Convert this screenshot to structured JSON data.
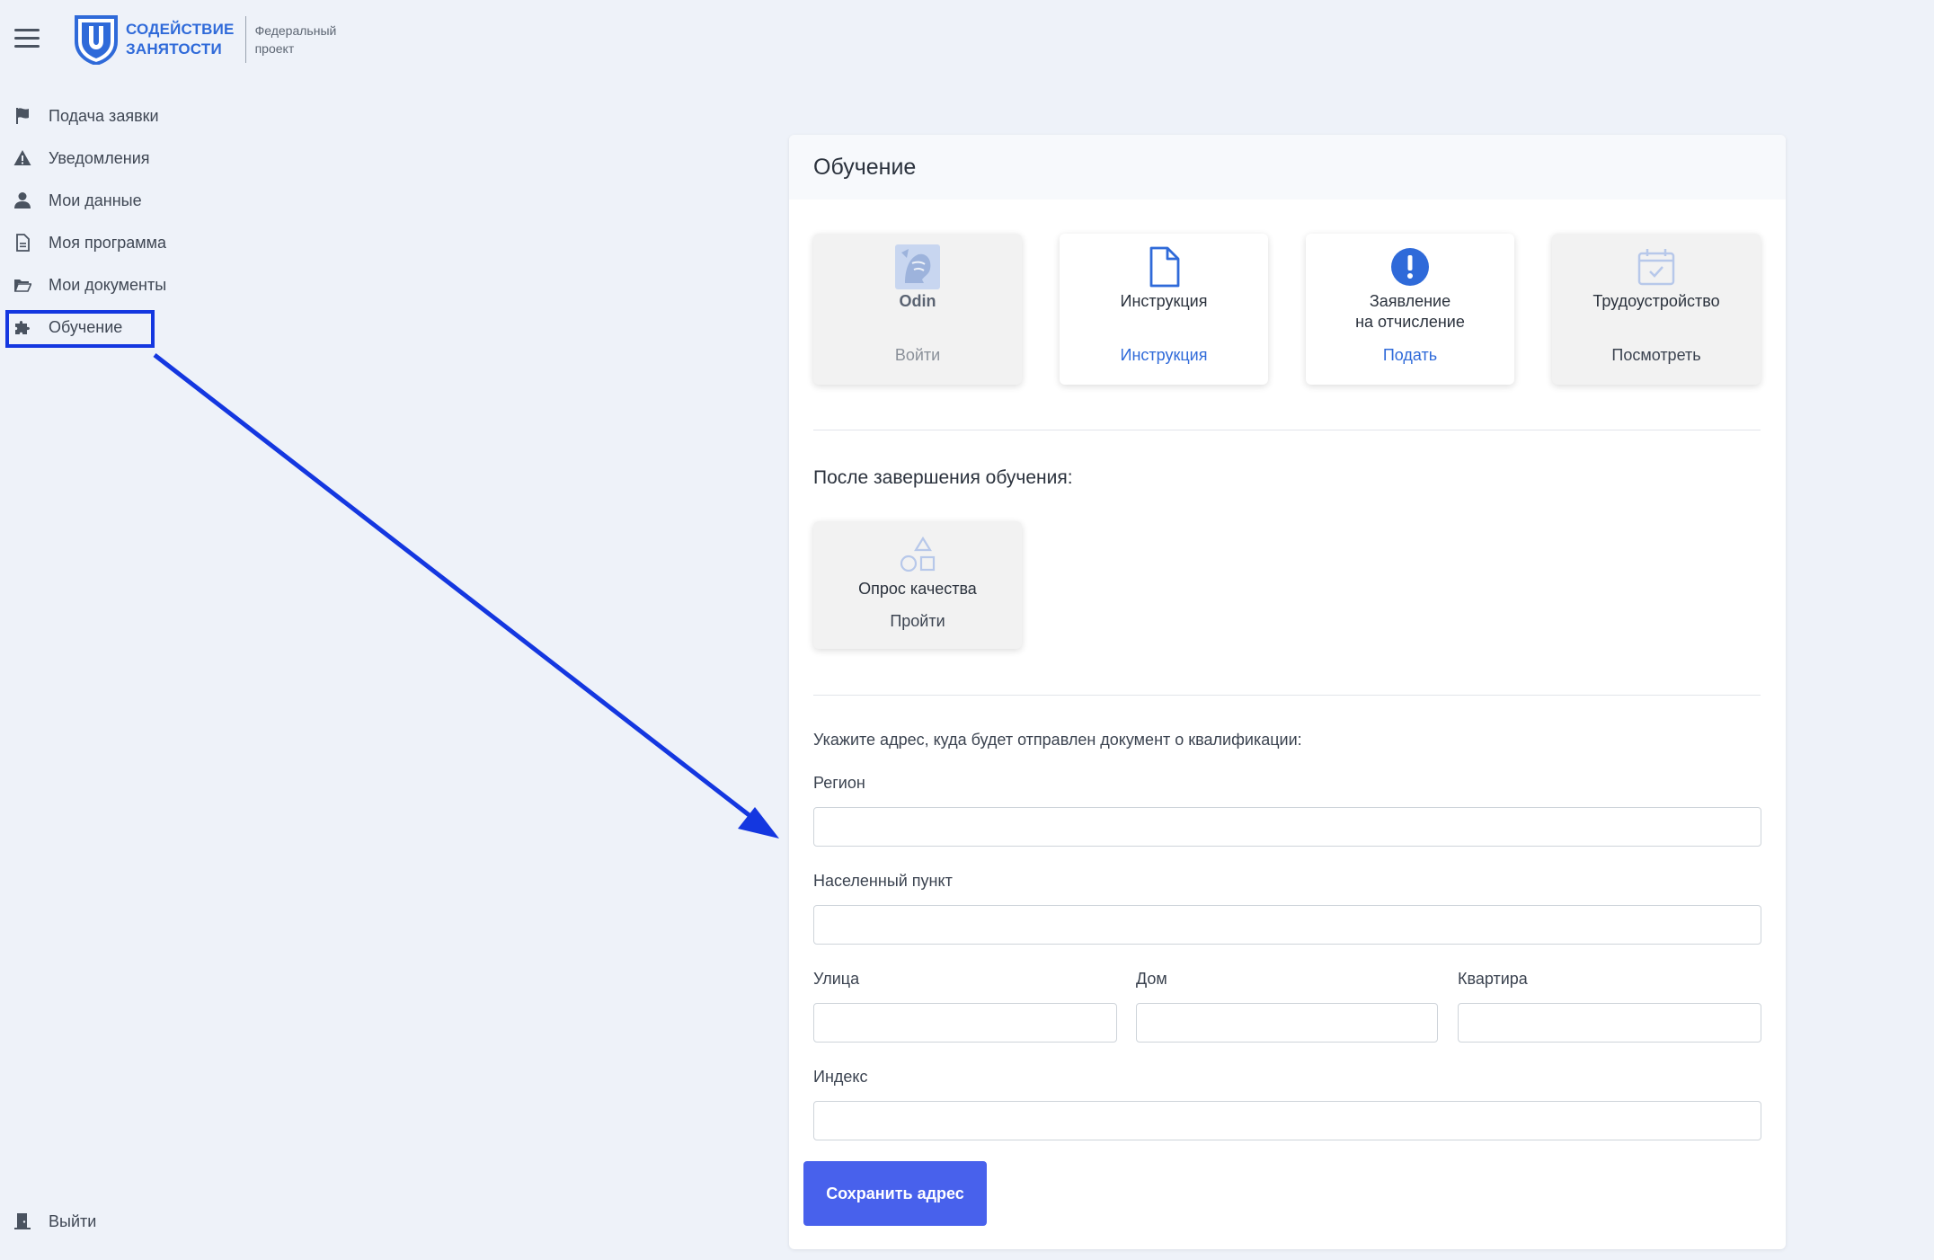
{
  "header": {
    "brand_line1": "СОДЕЙСТВИЕ",
    "brand_line2": "ЗАНЯТОСТИ",
    "subtitle_line1": "Федеральный",
    "subtitle_line2": "проект",
    "brand_color": "#2f6ad9"
  },
  "sidebar": {
    "items": [
      {
        "label": "Подача заявки",
        "icon": "flag-icon"
      },
      {
        "label": "Уведомления",
        "icon": "warning-icon"
      },
      {
        "label": "Мои данные",
        "icon": "user-icon"
      },
      {
        "label": "Моя программа",
        "icon": "document-icon"
      },
      {
        "label": "Мои документы",
        "icon": "folder-icon"
      },
      {
        "label": "Обучение",
        "icon": "puzzle-icon",
        "highlighted": true
      }
    ],
    "logout_label": "Выйти"
  },
  "main": {
    "title": "Обучение",
    "tiles": [
      {
        "title": "Odin",
        "link": "Войти",
        "icon": "odin-logo-icon",
        "disabled": true
      },
      {
        "title": "Инструкция",
        "link": "Инструкция",
        "icon": "file-icon",
        "disabled": false
      },
      {
        "title_line1": "Заявление",
        "title_line2": "на отчисление",
        "link": "Подать",
        "icon": "exclamation-circle-icon",
        "disabled": false
      },
      {
        "title": "Трудоустройство",
        "link": "Посмотреть",
        "icon": "calendar-check-icon",
        "disabled": true
      }
    ],
    "after_title": "После завершения обучения:",
    "survey": {
      "title": "Опрос качества",
      "link": "Пройти",
      "icon": "shapes-icon"
    },
    "address_note": "Укажите адрес, куда будет отправлен документ о квалификации:",
    "fields": {
      "region": {
        "label": "Регион",
        "value": ""
      },
      "locality": {
        "label": "Населенный пункт",
        "value": ""
      },
      "street": {
        "label": "Улица",
        "value": ""
      },
      "house": {
        "label": "Дом",
        "value": ""
      },
      "apartment": {
        "label": "Квартира",
        "value": ""
      },
      "index": {
        "label": "Индекс",
        "value": ""
      }
    },
    "save_button": "Сохранить адрес",
    "accent_color": "#4861ec",
    "annotation_color": "#1437e0"
  }
}
